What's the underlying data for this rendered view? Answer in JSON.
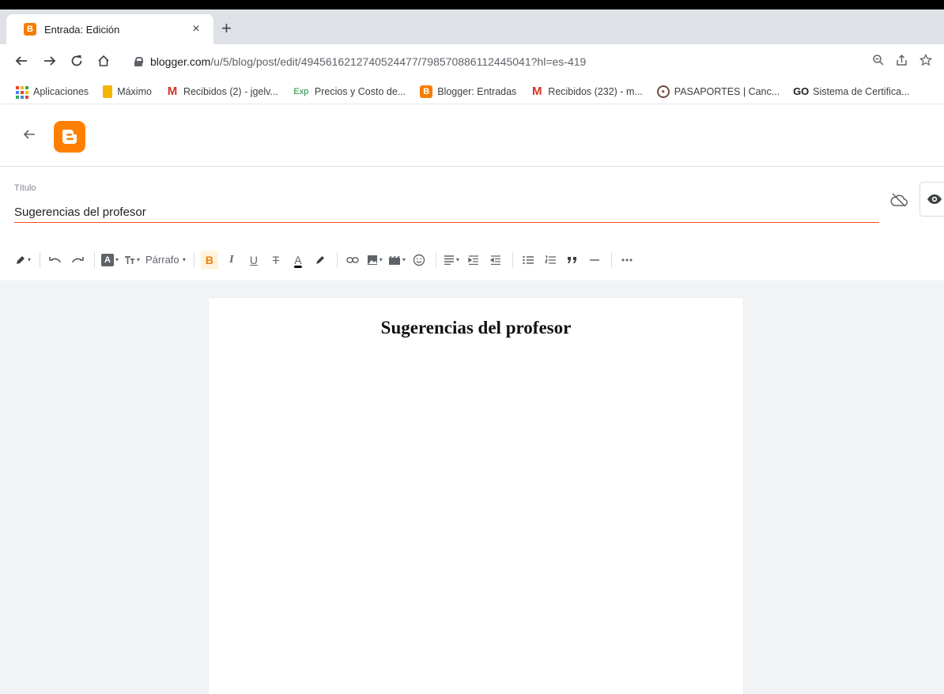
{
  "browser": {
    "tab": {
      "title": "Entrada: Edición",
      "favicon": "B",
      "close": "×"
    },
    "new_tab": "+",
    "url_host": "blogger.com",
    "url_path": "/u/5/blog/post/edit/4945616212740524477/798570886112445041?hl=es-419"
  },
  "bookmarks": [
    {
      "label": "Aplicaciones",
      "icon": "apps-grid-icon"
    },
    {
      "label": "Máximo",
      "icon": "doc-icon"
    },
    {
      "label": "Recibidos (2) - jgelv...",
      "icon": "gmail-icon"
    },
    {
      "label": "Precios y Costo de...",
      "icon": "exp-icon",
      "glyph": "Exp"
    },
    {
      "label": "Blogger: Entradas",
      "icon": "blogger-icon",
      "glyph": "B"
    },
    {
      "label": "Recibidos (232) - m...",
      "icon": "gmail-icon"
    },
    {
      "label": "PASAPORTES | Canc...",
      "icon": "passport-icon"
    },
    {
      "label": "Sistema de Certifica...",
      "icon": "go-icon",
      "glyph": "GO"
    }
  ],
  "editor": {
    "title_label": "Título",
    "title_value": "Sugerencias del profesor",
    "format_dropdown": "Párrafo",
    "post_heading": "Sugerencias del profesor"
  },
  "colors": {
    "blogger_orange": "#ff8000",
    "title_underline": "#f4511e",
    "canvas_bg": "#f1f3f4"
  }
}
